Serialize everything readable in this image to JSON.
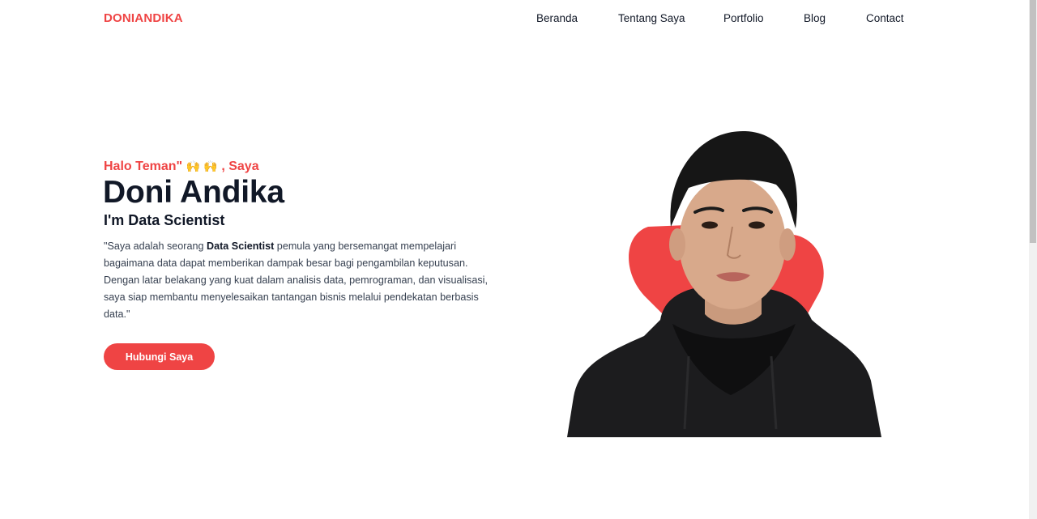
{
  "navbar": {
    "brand": "DONIANDIKA",
    "links": [
      {
        "label": "Beranda"
      },
      {
        "label": "Tentang Saya"
      },
      {
        "label": "Portfolio"
      },
      {
        "label": "Blog"
      },
      {
        "label": "Contact"
      }
    ]
  },
  "hero": {
    "greeting_pre": "Halo Teman\"",
    "greeting_emoji": "🙌 🙌",
    "greeting_post": ", Saya",
    "name": "Doni Andika",
    "role": "I'm Data Scientist",
    "description_pre": "\"Saya adalah seorang ",
    "description_bold": "Data Scientist",
    "description_post": " pemula yang bersemangat mempelajari bagaimana data dapat memberikan dampak besar bagi pengambilan keputusan. Dengan latar belakang yang kuat dalam analisis data, pemrograman, dan visualisasi, saya siap membantu menyelesaikan tantangan bisnis melalui pendekatan berbasis data.\"",
    "cta_label": "Hubungi Saya",
    "portrait_icon": "person-portrait"
  },
  "colors": {
    "accent": "#ef4444",
    "text": "#111827",
    "body_text": "#374151",
    "background": "#ffffff"
  }
}
